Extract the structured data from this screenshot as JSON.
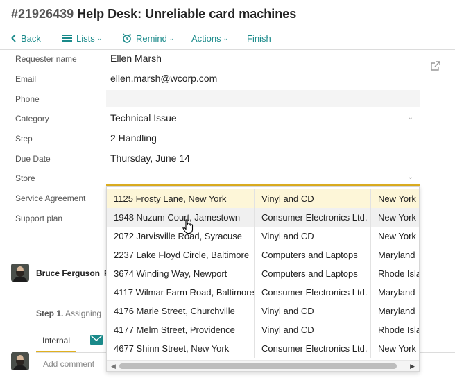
{
  "ticket": {
    "number": "#21926439",
    "title": "Help Desk: Unreliable card machines"
  },
  "toolbar": {
    "back": "Back",
    "lists": "Lists",
    "remind": "Remind",
    "actions": "Actions",
    "finish": "Finish"
  },
  "fields": {
    "requester": {
      "label": "Requester name",
      "value": "Ellen Marsh"
    },
    "email": {
      "label": "Email",
      "value": "ellen.marsh@wcorp.com"
    },
    "phone": {
      "label": "Phone",
      "value": ""
    },
    "category": {
      "label": "Category",
      "value": "Technical Issue"
    },
    "step": {
      "label": "Step",
      "value": "2 Handling"
    },
    "due_date": {
      "label": "Due Date",
      "value": "Thursday, June 14"
    },
    "store": {
      "label": "Store",
      "value": ""
    },
    "service_agreement": {
      "label": "Service Agreement"
    },
    "support_plan": {
      "label": "Support plan"
    }
  },
  "comment": {
    "author": "Bruce Ferguson",
    "author_extra": "F",
    "step_label": "Step 1.",
    "step_text": "Assigning",
    "tab_internal": "Internal",
    "add_placeholder": "Add comment"
  },
  "store_options": [
    {
      "address": "1125 Frosty Lane, New York",
      "type": "Vinyl and CD",
      "state": "New York"
    },
    {
      "address": "1948 Nuzum Court, Jamestown",
      "type": "Consumer Electronics Ltd.",
      "state": "New York"
    },
    {
      "address": "2072 Jarvisville Road, Syracuse",
      "type": "Vinyl and CD",
      "state": "New York"
    },
    {
      "address": "2237 Lake Floyd Circle, Baltimore",
      "type": "Computers and Laptops",
      "state": "Maryland"
    },
    {
      "address": "3674 Winding Way, Newport",
      "type": "Computers and Laptops",
      "state": "Rhode Isla"
    },
    {
      "address": "4117 Wilmar Farm Road, Baltimore",
      "type": "Consumer Electronics Ltd.",
      "state": "Maryland"
    },
    {
      "address": "4176 Marie Street, Churchville",
      "type": "Vinyl and CD",
      "state": "Maryland"
    },
    {
      "address": "4177 Melm Street, Providence",
      "type": "Vinyl and CD",
      "state": "Rhode Isla"
    },
    {
      "address": "4677 Shinn Street, New York",
      "type": "Consumer Electronics Ltd.",
      "state": "New York"
    }
  ],
  "colors": {
    "accent": "#1a8a8a",
    "highlight": "#e0b020",
    "selected_row": "#fdf6d8"
  }
}
